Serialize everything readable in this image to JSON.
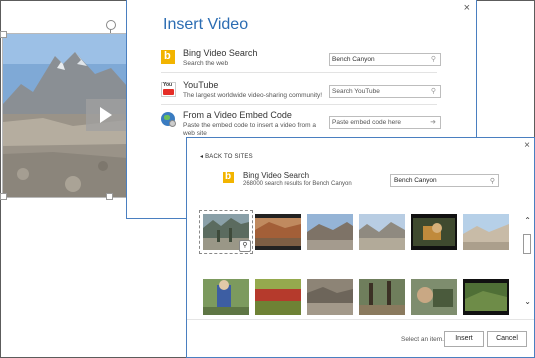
{
  "insert_video": {
    "title": "Insert Video",
    "close_label": "×",
    "sources": [
      {
        "title": "Bing Video Search",
        "subtitle": "Search the web",
        "input_value": "Bench Canyon",
        "input_placeholder": "",
        "icon": "bing-icon"
      },
      {
        "title": "YouTube",
        "subtitle": "The largest worldwide video-sharing community!",
        "input_value": "",
        "input_placeholder": "Search YouTube",
        "icon": "youtube-icon"
      },
      {
        "title": "From a Video Embed Code",
        "subtitle": "Paste the embed code to insert a video from a web site",
        "input_value": "",
        "input_placeholder": "Paste embed code here",
        "icon": "globe-icon"
      }
    ]
  },
  "bing_results": {
    "back_label": "◂ BACK TO SITES",
    "close_label": "×",
    "title": "Bing Video Search",
    "count_text": "268000 search results for Bench Canyon",
    "search_value": "Bench Canyon",
    "status_text": "Select an item.",
    "insert_label": "Insert",
    "cancel_label": "Cancel"
  },
  "colors": {
    "accent": "#2b6cb2",
    "bing": "#f2b400",
    "youtube": "#e52d27",
    "dialog_border": "#4a7fc0"
  }
}
